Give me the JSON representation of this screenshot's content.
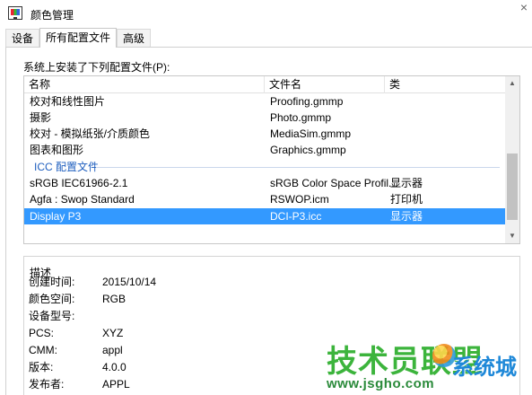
{
  "window": {
    "title": "颜色管理",
    "close_glyph": "×"
  },
  "tabs": [
    {
      "label": "设备",
      "active": false
    },
    {
      "label": "所有配置文件",
      "active": true
    },
    {
      "label": "高级",
      "active": false
    }
  ],
  "profiles": {
    "caption": "系统上安装了下列配置文件(P):",
    "columns": [
      "名称",
      "文件名",
      "类"
    ],
    "rows_top": [
      {
        "name": "校对和线性图片",
        "file": "Proofing.gmmp",
        "class": ""
      },
      {
        "name": "摄影",
        "file": "Photo.gmmp",
        "class": ""
      },
      {
        "name": "校对 - 模拟纸张/介质颜色",
        "file": "MediaSim.gmmp",
        "class": ""
      },
      {
        "name": "图表和图形",
        "file": "Graphics.gmmp",
        "class": ""
      }
    ],
    "group_label": "ICC 配置文件",
    "rows_icc": [
      {
        "name": "sRGB IEC61966-2.1",
        "file": "sRGB Color Space Profil...",
        "class": "显示器"
      },
      {
        "name": "Agfa : Swop Standard",
        "file": "RSWOP.icm",
        "class": "打印机"
      },
      {
        "name": "Display P3",
        "file": "DCI-P3.icc",
        "class": "显示器",
        "selected": true
      }
    ],
    "scroll_up": "▲",
    "scroll_down": "▼"
  },
  "description": {
    "title": "描述",
    "rows": [
      {
        "label": "创建时间:",
        "value": "2015/10/14"
      },
      {
        "label": "颜色空间:",
        "value": "RGB"
      },
      {
        "label": "设备型号:",
        "value": ""
      },
      {
        "label": "PCS:",
        "value": "XYZ"
      },
      {
        "label": "CMM:",
        "value": "appl"
      },
      {
        "label": "版本:",
        "value": "4.0.0"
      },
      {
        "label": "发布者:",
        "value": "APPL"
      }
    ]
  },
  "watermark": {
    "main": "技术员联盟",
    "brand": "系统城",
    "url": "www.jsgho.com"
  },
  "colors": {
    "selection": "#3399ff",
    "group_header": "#1f5fbf",
    "watermark_green": "#3cb43c",
    "watermark_blue": "#1e88d8"
  }
}
